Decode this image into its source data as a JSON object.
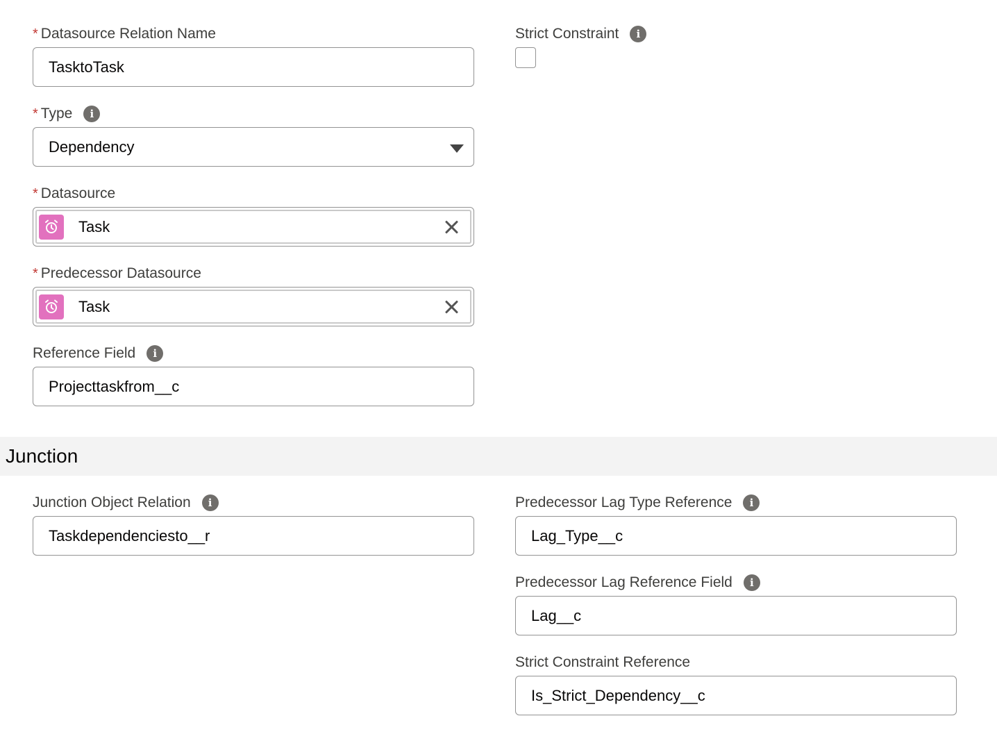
{
  "left": {
    "relation_name": {
      "required": "*",
      "label": "Datasource Relation Name",
      "value": "TasktoTask"
    },
    "type": {
      "required": "*",
      "label": "Type",
      "value": "Dependency"
    },
    "datasource": {
      "required": "*",
      "label": "Datasource",
      "value": "Task",
      "icon": "alarm-clock-icon"
    },
    "predecessor_datasource": {
      "required": "*",
      "label": "Predecessor Datasource",
      "value": "Task",
      "icon": "alarm-clock-icon"
    },
    "reference_field": {
      "label": "Reference Field",
      "value": "Projecttaskfrom__c"
    }
  },
  "right": {
    "strict_constraint": {
      "label": "Strict Constraint",
      "checked": false
    }
  },
  "junction": {
    "title": "Junction",
    "junction_object_relation": {
      "label": "Junction Object Relation",
      "value": "Taskdependenciesto__r"
    },
    "predecessor_lag_type_reference": {
      "label": "Predecessor Lag Type Reference",
      "value": "Lag_Type__c"
    },
    "predecessor_lag_reference_field": {
      "label": "Predecessor Lag Reference Field",
      "value": "Lag__c"
    },
    "strict_constraint_reference": {
      "label": "Strict Constraint Reference",
      "value": "Is_Strict_Dependency__c"
    }
  },
  "colors": {
    "required": "#c23934",
    "object_icon": "#e271be",
    "section_bg": "#f3f3f3",
    "info_icon": "#706e6b"
  }
}
